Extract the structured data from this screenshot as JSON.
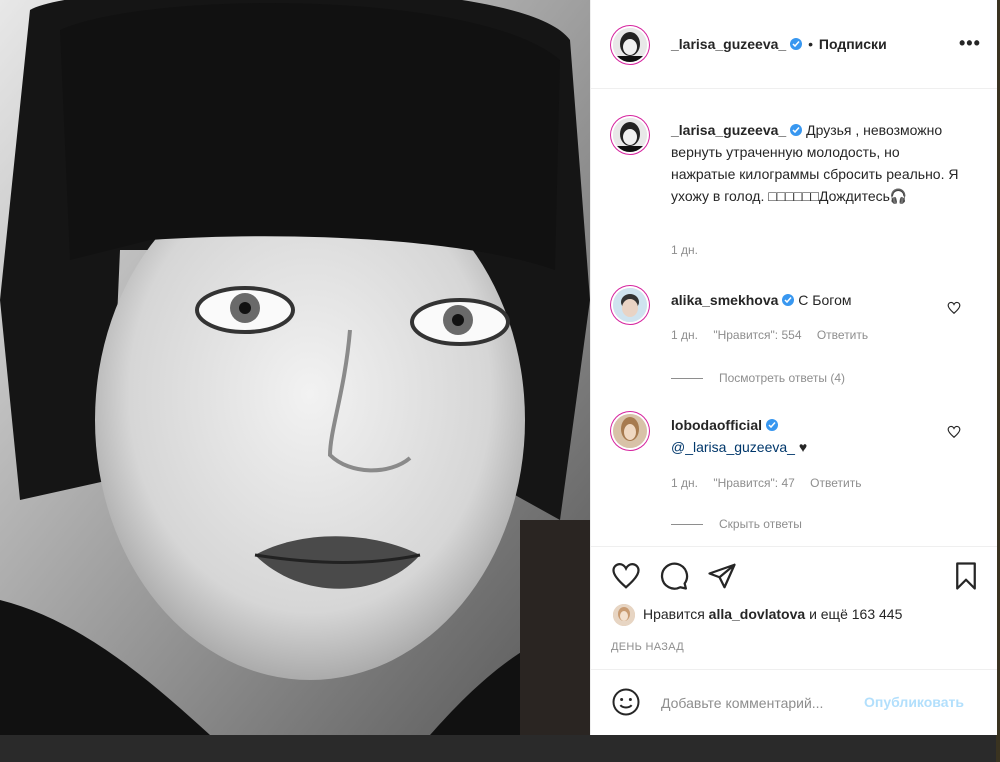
{
  "post": {
    "author": "_larisa_guzeeva_",
    "follow_label": "Подписки",
    "more_label": "•••",
    "separator": "•"
  },
  "caption": {
    "author": "_larisa_guzeeva_",
    "text": "Друзья , невозможно вернуть утраченную молодость, но нажратые килограммы сбросить реально. Я ухожу в голод. □□□□□□Дождитесь🎧",
    "time": "1 дн."
  },
  "comments": [
    {
      "author": "alika_smekhova",
      "text": "С Богом",
      "time": "1 дн.",
      "likes": "\"Нравится\": 554",
      "reply_label": "Ответить",
      "replies_label": "Посмотреть ответы (4)"
    },
    {
      "author": "lobodaofficial",
      "mention": "@_larisa_guzeeva_",
      "emoji": "♥",
      "time": "1 дн.",
      "likes": "\"Нравится\": 47",
      "reply_label": "Ответить",
      "replies_label": "Скрыть ответы"
    }
  ],
  "actions": {
    "icons": [
      "heart-icon",
      "comment-icon",
      "share-icon",
      "bookmark-icon"
    ],
    "likes_prefix": "Нравится",
    "likes_user": "alla_dovlatova",
    "likes_suffix": "и ещё 163 445",
    "time_ago": "ДЕНЬ НАЗАД"
  },
  "add_comment": {
    "placeholder": "Добавьте комментарий...",
    "publish_label": "Опубликовать"
  },
  "colors": {
    "verified": "#3897f0",
    "link": "#00376b",
    "muted": "#8e8e8e",
    "publish_disabled": "#b2dffc"
  }
}
